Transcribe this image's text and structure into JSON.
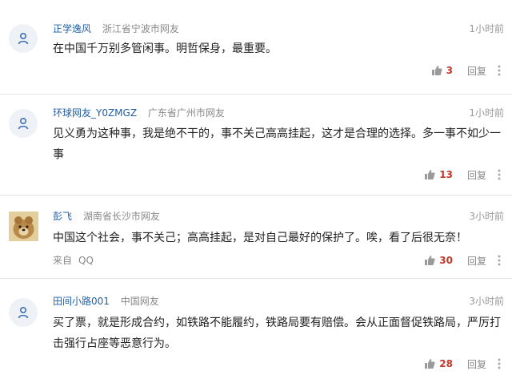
{
  "comments": [
    {
      "username": "正学逸风",
      "location": "浙江省宁波市网友",
      "time": "1小时前",
      "text": "在中国千万别多管闲事。明哲保身，最重要。",
      "likes": "3",
      "reply": "回复",
      "avatar": "user-icon"
    },
    {
      "username": "环球网友_Y0ZMGZ",
      "location": "广东省广州市网友",
      "time": "1小时前",
      "text": "见义勇为这种事，我是绝不干的，事不关己高高挂起，这才是合理的选择。多一事不如少一事",
      "likes": "13",
      "reply": "回复",
      "avatar": "user-icon"
    },
    {
      "username": "彭飞",
      "location": "湖南省长沙市网友",
      "time": "3小时前",
      "text": "中国这个社会，事不关己；高高挂起，是对自己最好的保护了。唉，看了后很无奈！",
      "likes": "30",
      "reply": "回复",
      "source": "来自",
      "source_app": "QQ",
      "avatar": "photo-avatar"
    },
    {
      "username": "田间小路001",
      "location": "中国网友",
      "time": "3小时前",
      "text": "买了票，就是形成合约，如铁路不能履约，铁路局要有赔偿。会从正面督促铁路局，严厉打击强行占座等恶意行为。",
      "likes": "28",
      "reply": "回复",
      "avatar": "user-icon"
    }
  ],
  "colors": {
    "username": "#1f5fa8",
    "like_count": "#c0392b",
    "divider": "#e4e4e4"
  }
}
